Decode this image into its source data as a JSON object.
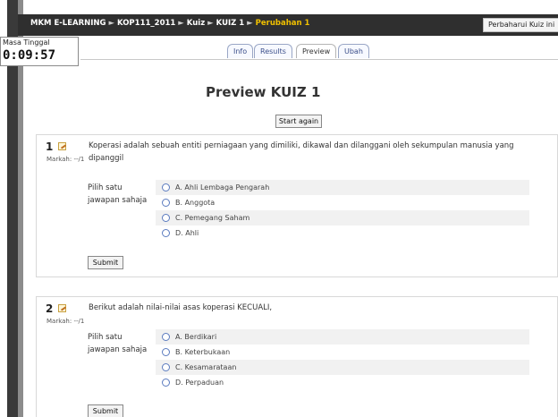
{
  "header": {
    "breadcrumbs": [
      "MKM E-LEARNING",
      "KOP111_2011",
      "Kuiz",
      "KUIZ 1",
      "Perubahan 1"
    ],
    "separator": "►",
    "update_button": "Perbaharui Kuiz ini"
  },
  "timer": {
    "label": "Masa Tinggal",
    "value": "0:09:57"
  },
  "tabs": [
    {
      "label": "Info"
    },
    {
      "label": "Results"
    },
    {
      "label": "Preview"
    },
    {
      "label": "Ubah"
    }
  ],
  "title": "Preview KUIZ 1",
  "start_again_label": "Start again",
  "questions": [
    {
      "number": "1",
      "mark": "Markah: --/1",
      "text": "Koperasi adalah sebuah entiti perniagaan yang dimiliki, dikawal dan dilanggani oleh sekumpulan manusia yang dipanggil",
      "prompt": "Pilih satu jawapan sahaja",
      "options": [
        "A. Ahli Lembaga Pengarah",
        "B. Anggota",
        "C. Pemegang Saham",
        "D. Ahli"
      ],
      "submit_label": "Submit"
    },
    {
      "number": "2",
      "mark": "Markah: --/1",
      "text": "Berikut adalah nilai-nilai asas koperasi KECUALI,",
      "prompt": "Pilih satu jawapan sahaja",
      "options": [
        "A. Berdikari",
        "B. Keterbukaan",
        "C. Kesamarataan",
        "D. Perpaduan"
      ],
      "submit_label": "Submit"
    }
  ],
  "icons": {
    "edit": "edit-pencil-icon",
    "radio": "radio-button-icon"
  },
  "colors": {
    "top_bar": "#2f2f2f",
    "current_crumb": "#f0c000",
    "tab_text": "#3b4f8a"
  }
}
